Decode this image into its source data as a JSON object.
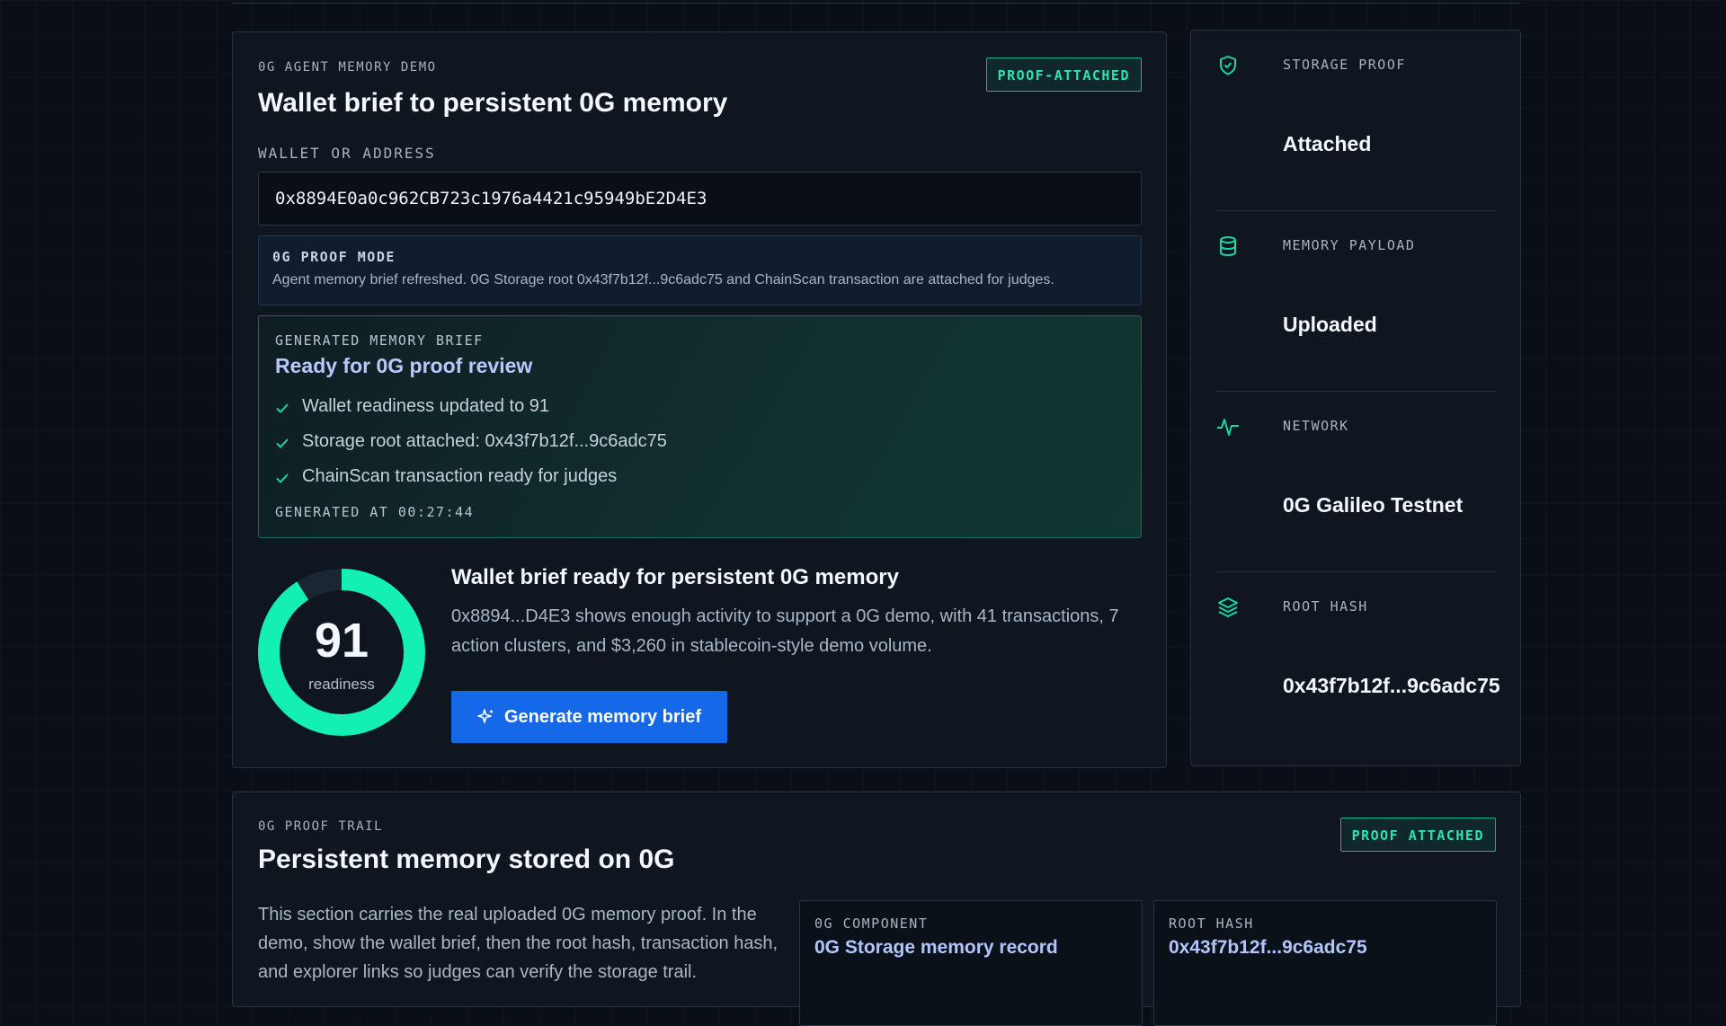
{
  "main": {
    "eyebrow": "0G AGENT MEMORY DEMO",
    "title": "Wallet brief to persistent 0G memory",
    "badge": "PROOF-ATTACHED",
    "wallet_label": "WALLET OR ADDRESS",
    "wallet_value": "0x8894E0a0c962CB723c1976a4421c95949bE2D4E3",
    "proof_mode": {
      "label": "0G PROOF MODE",
      "text": "Agent memory brief refreshed. 0G Storage root 0x43f7b12f...9c6adc75 and ChainScan transaction are attached for judges."
    },
    "brief": {
      "eyebrow": "GENERATED MEMORY BRIEF",
      "title": "Ready for 0G proof review",
      "items": [
        "Wallet readiness updated to 91",
        "Storage root attached: 0x43f7b12f...9c6adc75",
        "ChainScan transaction ready for judges"
      ],
      "generated_at": "GENERATED AT 00:27:44"
    },
    "readiness": {
      "score": "91",
      "score_value": 91,
      "label": "readiness",
      "headline": "Wallet brief ready for persistent 0G memory",
      "description": "0x8894...D4E3 shows enough activity to support a 0G demo, with 41 transactions, 7 action clusters, and $3,260 in stablecoin-style demo volume."
    },
    "generate_button": "Generate memory brief"
  },
  "side": {
    "rows": [
      {
        "label": "STORAGE PROOF",
        "value": "Attached",
        "icon": "shield-check-icon"
      },
      {
        "label": "MEMORY PAYLOAD",
        "value": "Uploaded",
        "icon": "database-icon"
      },
      {
        "label": "NETWORK",
        "value": "0G Galileo Testnet",
        "icon": "activity-icon"
      },
      {
        "label": "ROOT HASH",
        "value": "0x43f7b12f...9c6adc75",
        "icon": "layers-icon"
      }
    ]
  },
  "trail": {
    "eyebrow": "0G PROOF TRAIL",
    "title": "Persistent memory stored on 0G",
    "badge": "PROOF ATTACHED",
    "description": "This section carries the real uploaded 0G memory proof. In the demo, show the wallet brief, then the root hash, transaction hash, and explorer links so judges can verify the storage trail.",
    "cards": [
      {
        "label": "0G COMPONENT",
        "value": "0G Storage memory record"
      },
      {
        "label": "ROOT HASH",
        "value": "0x43f7b12f...9c6adc75"
      }
    ]
  },
  "colors": {
    "accent_green": "#14f0b4",
    "button_blue": "#1569e8",
    "link_blue": "#b3c5ff"
  }
}
